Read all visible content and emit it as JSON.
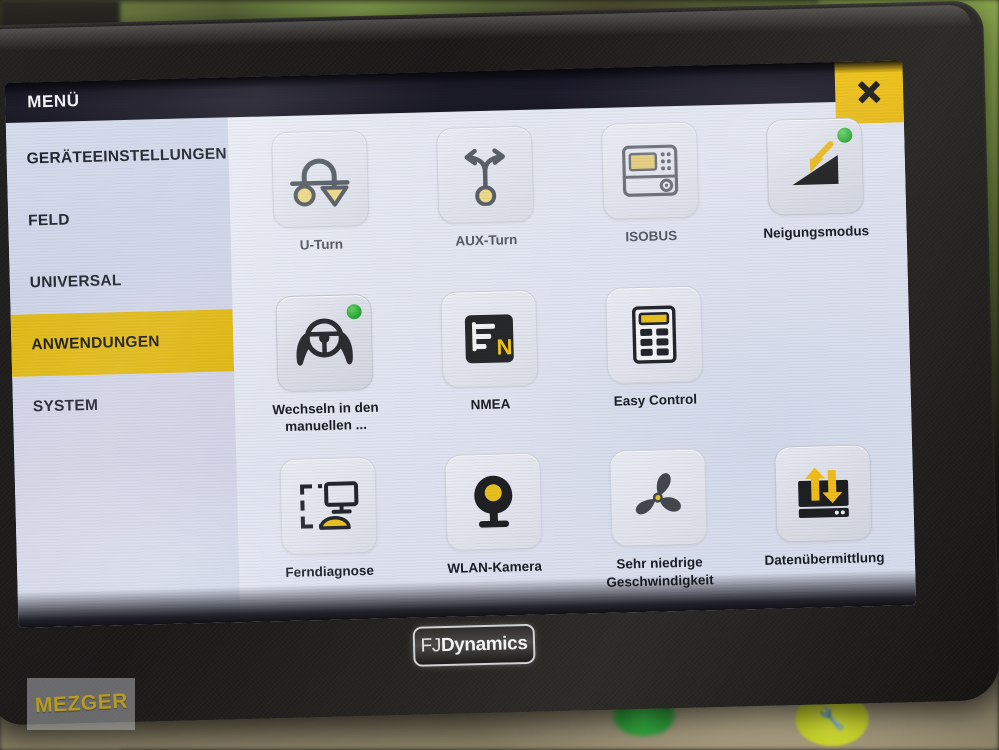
{
  "device": {
    "brand_prefix": "FJ",
    "brand_suffix": "Dynamics",
    "watermark": "MEZGER"
  },
  "header": {
    "title": "MENÜ",
    "close_icon": "close-x-icon"
  },
  "sidebar": {
    "items": [
      {
        "label": "GERÄTEEINSTELLUNGEN",
        "active": false
      },
      {
        "label": "FELD",
        "active": false
      },
      {
        "label": "UNIVERSAL",
        "active": false
      },
      {
        "label": "ANWENDUNGEN",
        "active": true
      },
      {
        "label": "SYSTEM",
        "active": false
      }
    ],
    "active_color": "#e0b810"
  },
  "apps": {
    "rows": [
      [
        {
          "label": "U-Turn",
          "icon": "u-turn-icon",
          "badge": false,
          "muted": true
        },
        {
          "label": "AUX-Turn",
          "icon": "aux-turn-icon",
          "badge": false,
          "muted": true
        },
        {
          "label": "ISOBUS",
          "icon": "isobus-terminal-icon",
          "badge": false,
          "muted": true
        },
        {
          "label": "Neigungsmodus",
          "icon": "slope-mode-icon",
          "badge": true,
          "muted": false
        }
      ],
      [
        {
          "label": "Wechseln in den manuellen ...",
          "icon": "steering-wheel-hands-icon",
          "badge": true,
          "muted": false
        },
        {
          "label": "NMEA",
          "icon": "nmea-document-icon",
          "badge": false,
          "muted": false
        },
        {
          "label": "Easy Control",
          "icon": "calculator-icon",
          "badge": false,
          "muted": false
        },
        {
          "label": "",
          "icon": "",
          "badge": false,
          "muted": false
        }
      ],
      [
        {
          "label": "Ferndiagnose",
          "icon": "remote-diagnostics-icon",
          "badge": false,
          "muted": false
        },
        {
          "label": "WLAN-Kamera",
          "icon": "wlan-camera-icon",
          "badge": false,
          "muted": false
        },
        {
          "label": "Sehr niedrige Geschwindigkeit",
          "icon": "propeller-icon",
          "badge": false,
          "muted": false
        },
        {
          "label": "Datenübermittlung",
          "icon": "data-transfer-icon",
          "badge": false,
          "muted": false
        }
      ]
    ]
  },
  "colors": {
    "accent_yellow": "#e0b810",
    "icon_yellow": "#e8c63a",
    "status_green": "#28a335",
    "icon_dark": "#23262c",
    "screen_bg": "#dde1ef"
  }
}
